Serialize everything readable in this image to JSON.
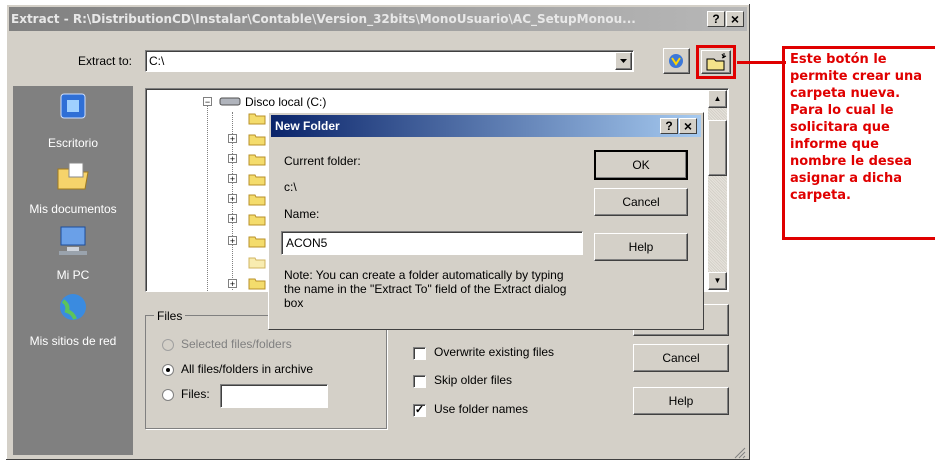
{
  "window": {
    "title": "Extract - R:\\DistributionCD\\Instalar\\Contable\\Version_32bits\\MonoUsuario\\AC_SetupMonou...",
    "help_btn": "?",
    "close_btn": "×"
  },
  "extract_to": {
    "label": "Extract to:",
    "value": "C:\\"
  },
  "sidebar": {
    "items": [
      {
        "label": "Escritorio",
        "icon": "desktop-icon"
      },
      {
        "label": "Mis documentos",
        "icon": "my-documents-icon"
      },
      {
        "label": "Mi PC",
        "icon": "my-computer-icon"
      },
      {
        "label": "Mis sitios de red",
        "icon": "network-places-icon"
      }
    ]
  },
  "tree": {
    "root_label": "Disco local (C:)"
  },
  "new_folder": {
    "title": "New Folder",
    "help_btn": "?",
    "close_btn": "×",
    "current_folder_label": "Current folder:",
    "current_folder_value": "c:\\",
    "name_label": "Name:",
    "name_value": "ACON5",
    "ok": "OK",
    "cancel": "Cancel",
    "help": "Help",
    "note": "Note: You can create a folder automatically by typing the name in the \"Extract To\" field of the Extract dialog box"
  },
  "files_group": {
    "legend": "Files",
    "option_selected": "Selected files/folders",
    "option_all": "All files/folders in archive",
    "option_files": "Files:"
  },
  "options": {
    "overwrite": "Overwrite existing files",
    "skip_older": "Skip older files",
    "use_folder_names": "Use folder names",
    "check_mark": "✓"
  },
  "buttons": {
    "cancel": "Cancel",
    "help": "Help"
  },
  "annotation": {
    "text": "Este botón le permite crear una carpeta nueva. Para lo cual le solicitara que informe que nombre le desea asignar a dicha carpeta.",
    "color": "#ff0000"
  }
}
